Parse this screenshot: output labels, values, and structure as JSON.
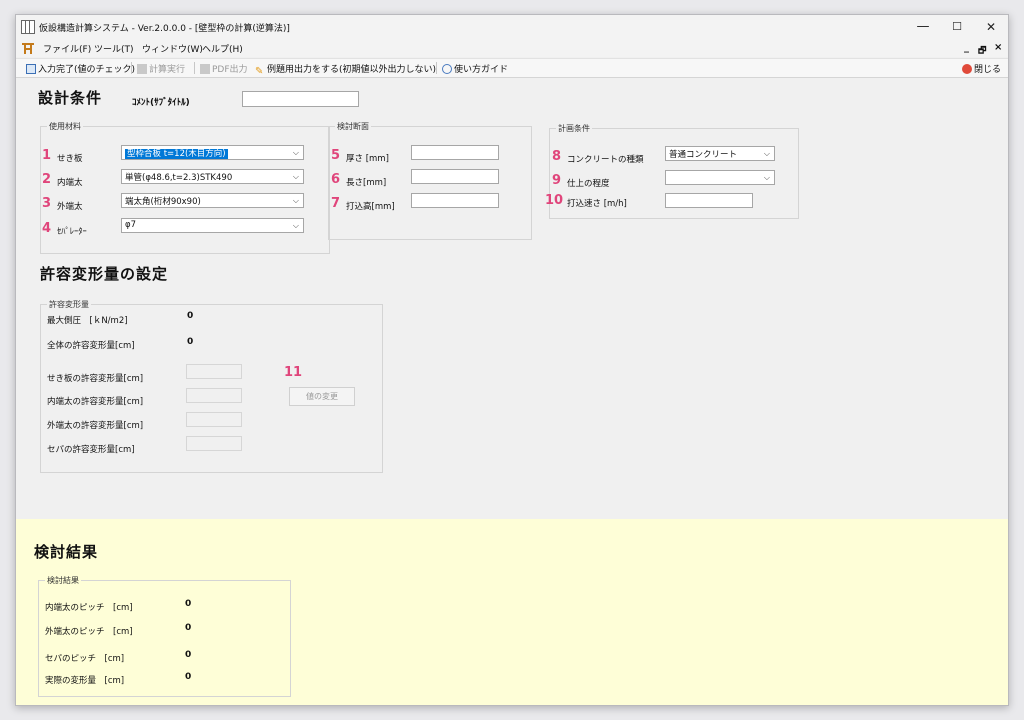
{
  "window": {
    "title": "仮設構造計算システム - Ver.2.0.0.0 - [壁型枠の計算(逆算法)]",
    "controls": {
      "minimize": "—",
      "maximize": "☐",
      "close": "✕"
    }
  },
  "menu": {
    "items": [
      "ファイル(F)",
      "ツール(T)",
      "ウィンドウ(W)",
      "ヘルプ(H)"
    ],
    "mdi": {
      "minimize": "_",
      "restore": "🗗",
      "close": "×"
    }
  },
  "toolbar": {
    "input_done": "入力完了(値のチェック)",
    "calc_run": "計算実行",
    "pdf_out": "PDF出力",
    "example_out": "例題用出力をする(初期値以外出力しない)",
    "guide": "使い方ガイド",
    "close": "閉じる"
  },
  "design": {
    "heading": "設計条件",
    "comment_label": "ｺﾒﾝﾄ(ｻﾌﾞﾀｲﾄﾙ)",
    "comment_value": "",
    "materials": {
      "legend": "使用材料",
      "rows": [
        {
          "num": "1",
          "label": "せき板",
          "value": "型枠合板 t=12(木目方向)"
        },
        {
          "num": "2",
          "label": "内端太",
          "value": "単管(φ48.6,t=2.3)STK490"
        },
        {
          "num": "3",
          "label": "外端太",
          "value": "端太角(桁材90x90)"
        },
        {
          "num": "4",
          "label": "ｾﾊﾟﾚｰﾀｰ",
          "value": "φ7"
        }
      ]
    },
    "section": {
      "legend": "検討断面",
      "rows": [
        {
          "num": "5",
          "label": "厚さ [mm]",
          "value": ""
        },
        {
          "num": "6",
          "label": "長さ[mm]",
          "value": ""
        },
        {
          "num": "7",
          "label": "打込高[mm]",
          "value": ""
        }
      ]
    },
    "plan": {
      "legend": "計画条件",
      "rows": [
        {
          "num": "8",
          "label": "コンクリートの種類",
          "value": "普通コンクリート"
        },
        {
          "num": "9",
          "label": "仕上の程度",
          "value": ""
        },
        {
          "num": "10",
          "label": "打込速さ [m/h]",
          "value": ""
        }
      ]
    }
  },
  "deform": {
    "heading": "許容変形量の設定",
    "legend": "許容変形量",
    "max_pressure_label": "最大側圧　[ｋN/m2]",
    "max_pressure_value": "0",
    "total_label": "全体の許容変形量[cm]",
    "total_value": "0",
    "marker": "11",
    "rows": [
      {
        "label": "せき板の許容変形量[cm]"
      },
      {
        "label": "内端太の許容変形量[cm]"
      },
      {
        "label": "外端太の許容変形量[cm]"
      },
      {
        "label": "セパの許容変形量[cm]"
      }
    ],
    "change_button": "値の変更"
  },
  "results": {
    "heading": "検討結果",
    "legend": "検討結果",
    "rows": [
      {
        "label": "内端太のピッチ　[cm]",
        "value": "0"
      },
      {
        "label": "外端太のピッチ　[cm]",
        "value": "0"
      },
      {
        "label": "セパのピッチ　[cm]",
        "value": "0"
      },
      {
        "label": "実際の変形量　[cm]",
        "value": "0"
      }
    ]
  },
  "colors": {
    "marker": "#e0457b",
    "results_bg": "#fefed7",
    "selection": "#0078d7"
  }
}
